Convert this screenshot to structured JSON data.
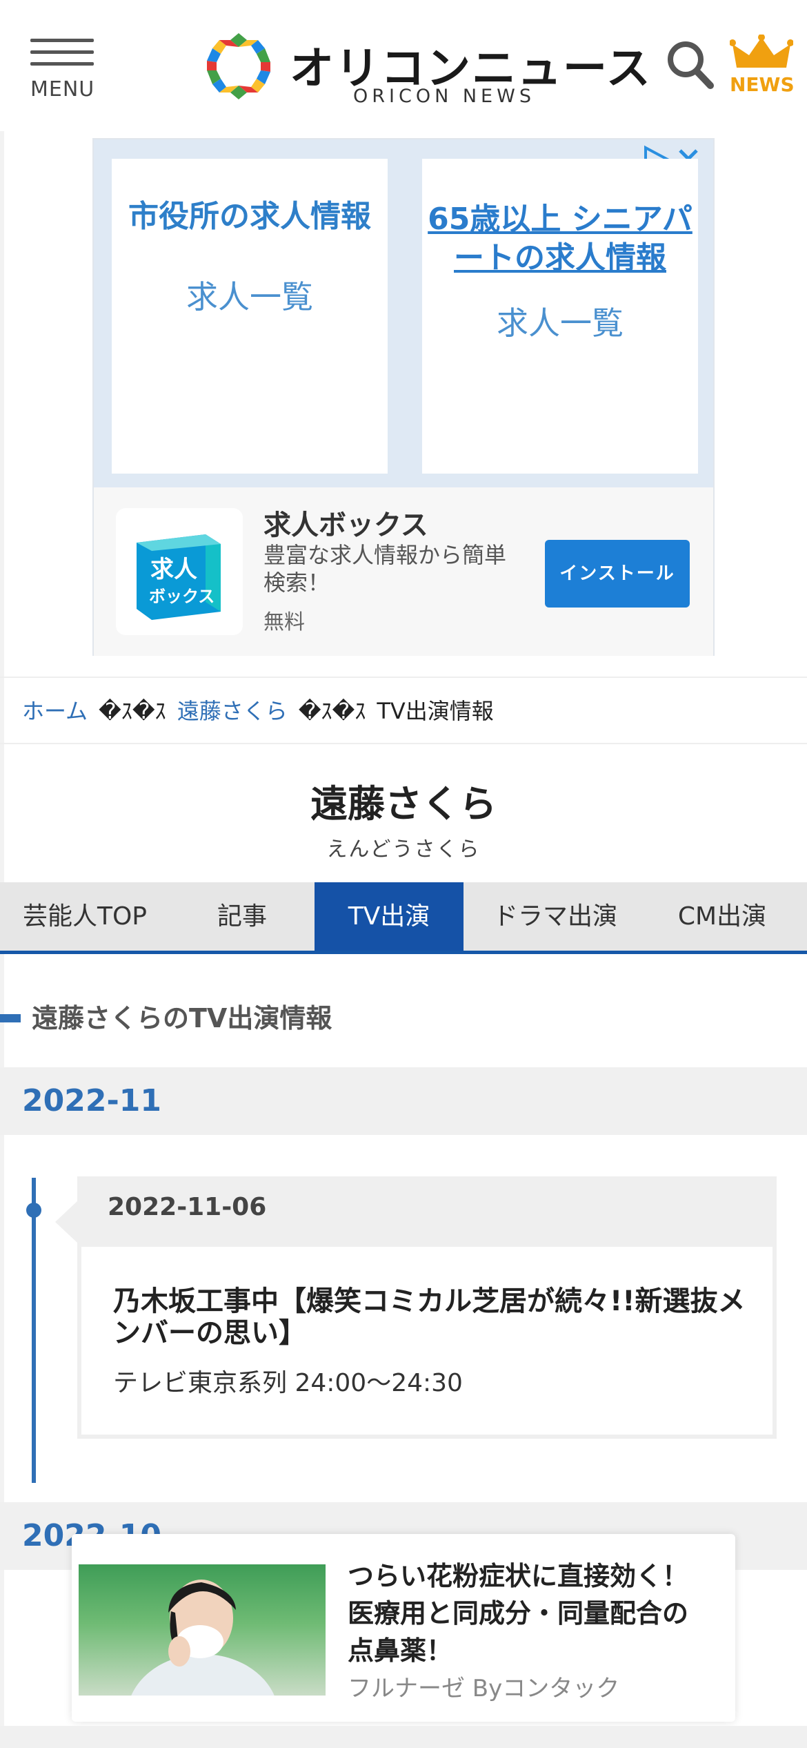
{
  "header": {
    "menu_label": "MENU",
    "logo_text": "オリコンニュース",
    "logo_sub": "ORICON NEWS",
    "news_label": "NEWS",
    "brand_colors": [
      "#e53935",
      "#fbc02d",
      "#43a047",
      "#1e88e5"
    ]
  },
  "ad": {
    "card1_title": "市役所の求人情報",
    "card1_sub": "求人一覧",
    "card2_title": "65歳以上 シニアパートの求人情報",
    "card2_sub": "求人一覧",
    "app_icon_text_1": "求人",
    "app_icon_text_2": "ボックス",
    "app_name": "求人ボックス",
    "app_desc": "豊富な求人情報から簡単検索！",
    "app_price": "無料",
    "install_label": "インストール"
  },
  "breadcrumb": {
    "home": "ホーム",
    "sep": "�ｽ�ｽ",
    "person": "遠藤さくら",
    "current": "TV出演情報"
  },
  "person": {
    "name": "遠藤さくら",
    "kana": "えんどうさくら"
  },
  "tabs": [
    {
      "label": "芸能人TOP"
    },
    {
      "label": "記事"
    },
    {
      "label": "TV出演"
    },
    {
      "label": "ドラマ出演"
    },
    {
      "label": "CM出演"
    }
  ],
  "section": {
    "title": "遠藤さくらのTV出演情報",
    "month1": "2022-11",
    "month2": "2022-10"
  },
  "entries": [
    {
      "date": "2022-11-06",
      "title": "乃木坂工事中【爆笑コミカル芝居が続々!!新選抜メンバーの思い】",
      "channel": "テレビ東京系列 24:00〜24:30"
    }
  ],
  "sticky_ad": {
    "title": "つらい花粉症状に直接効く！医療用と同成分・同量配合の点鼻薬！",
    "sponsor": "フルナーゼ Byコンタック"
  },
  "colors": {
    "accent": "#2f6fb6",
    "tab_active": "#1552a7",
    "install_button": "#1d7fd6",
    "news_gold": "#f0a010"
  }
}
